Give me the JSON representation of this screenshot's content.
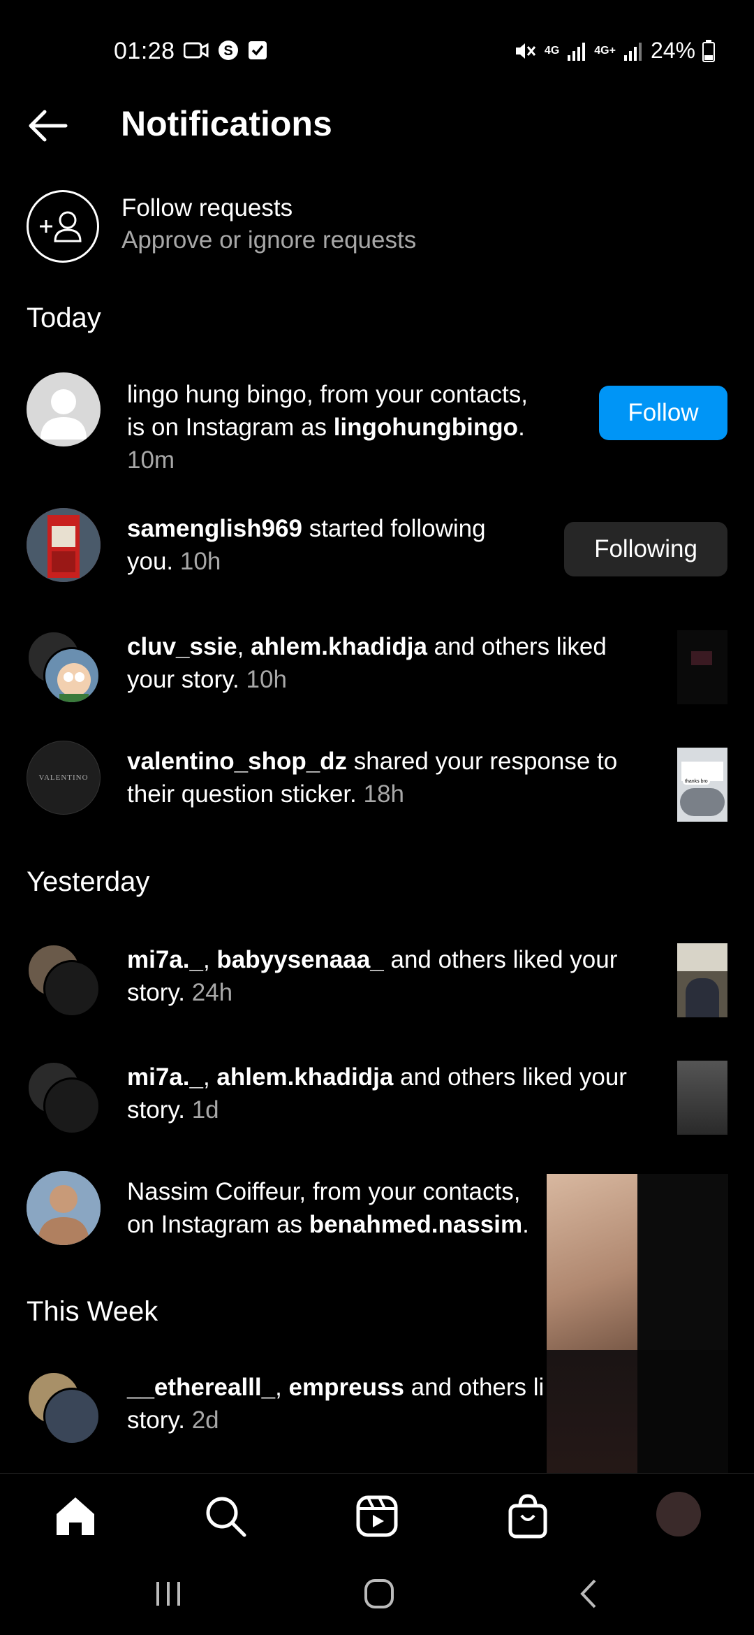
{
  "status_bar": {
    "time": "01:28",
    "network_1": "4G",
    "network_2": "4G+",
    "battery": "24%"
  },
  "header": {
    "title": "Notifications"
  },
  "follow_requests": {
    "title": "Follow requests",
    "subtitle": "Approve or ignore requests"
  },
  "sections": {
    "today": "Today",
    "yesterday": "Yesterday",
    "this_week": "This Week"
  },
  "notifications": [
    {
      "pre": "lingo hung bingo, from your contacts,",
      "line2_pre": "is on Instagram as ",
      "bold": "lingohungbingo",
      "line2_post": ".",
      "time": "10m",
      "action": "Follow"
    },
    {
      "bold": "samenglish969",
      "text": " started following",
      "line2": "you.",
      "time": "10h",
      "action": "Following"
    },
    {
      "bold1": "cluv_ssie",
      "sep": ", ",
      "bold2": "ahlem.khadidja",
      "text": " and others liked",
      "line2": "your story.",
      "time": "10h"
    },
    {
      "bold": "valentino_shop_dz",
      "text": " shared your response to",
      "line2": "their question sticker.",
      "time": "18h",
      "avatar_text": "VALENTINO",
      "thumb_text": "thanks bro"
    },
    {
      "bold1": "mi7a._",
      "sep": ", ",
      "bold2": "babyysenaaa_",
      "text": " and others liked your",
      "line2": "story.",
      "time": "24h"
    },
    {
      "bold1": "mi7a._",
      "sep": ", ",
      "bold2": "ahlem.khadidja",
      "text": " and others liked your",
      "line2": "story.",
      "time": "1d"
    },
    {
      "pre": "Nassim Coiffeur, from your contacts,",
      "line2_pre": "on Instagram as ",
      "bold": "benahmed.nassim",
      "line2_post": "."
    },
    {
      "bold1": "__etherealll_",
      "sep": ", ",
      "bold2": "empreuss",
      "text": " and others li",
      "line2": "story.",
      "time": "2d"
    }
  ],
  "colors": {
    "accent": "#0095f6",
    "background": "#000000",
    "secondary_text": "#a8a8a8",
    "button_dark": "#262626"
  }
}
